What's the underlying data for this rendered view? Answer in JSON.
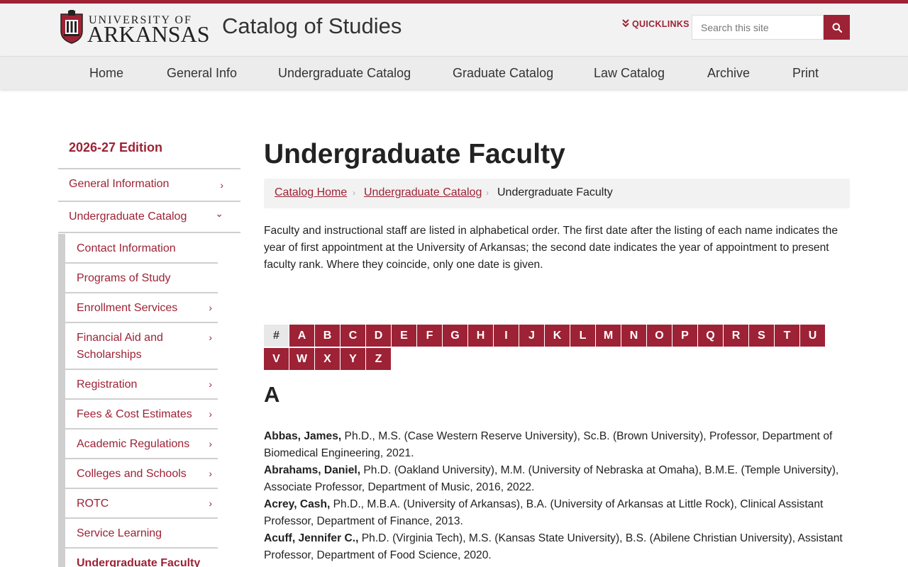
{
  "colors": {
    "brand": "#9d2235",
    "header_bg": "#f2f2f2",
    "nav_bg": "#ececec"
  },
  "header": {
    "logo_top": "UNIVERSITY OF",
    "logo_main": "ARKANSAS",
    "site_title": "Catalog of Studies",
    "quicklinks": "QUICKLINKS",
    "quicklinks_icon": "double-chevron-down-icon",
    "search_placeholder": "Search this site",
    "search_icon": "search-icon"
  },
  "nav": [
    "Home",
    "General Info",
    "Undergraduate Catalog",
    "Graduate Catalog",
    "Law Catalog",
    "Archive",
    "Print"
  ],
  "sidebar": {
    "edition": "2026-27 Edition",
    "top_items": [
      {
        "label": "General Information",
        "icon": "chevron-right-icon",
        "chev": "›"
      },
      {
        "label": "Undergraduate Catalog",
        "icon": "chevron-down-icon",
        "chev": "⌄"
      }
    ],
    "sub_items": [
      {
        "label": "Contact Information",
        "has_children": false
      },
      {
        "label": "Programs of Study",
        "has_children": false
      },
      {
        "label": "Enrollment Services",
        "has_children": true
      },
      {
        "label": "Financial Aid and Scholarships",
        "has_children": true
      },
      {
        "label": "Registration",
        "has_children": true
      },
      {
        "label": "Fees & Cost Estimates",
        "has_children": true
      },
      {
        "label": "Academic Regulations",
        "has_children": true
      },
      {
        "label": "Colleges and Schools",
        "has_children": true
      },
      {
        "label": "ROTC",
        "has_children": true
      },
      {
        "label": "Service Learning",
        "has_children": false
      },
      {
        "label": "Undergraduate Faculty",
        "has_children": false,
        "current": true
      }
    ]
  },
  "main": {
    "title": "Undergraduate Faculty",
    "breadcrumb": {
      "links": [
        "Catalog Home",
        "Undergraduate Catalog"
      ],
      "current": "Undergraduate Faculty"
    },
    "intro": "Faculty and instructional staff are listed in alphabetical order. The first date after the listing of each name indicates the year of first appointment at the University of Arkansas; the second date indicates the year of appointment to present faculty rank. Where they coincide, only one date is given.",
    "az": [
      "#",
      "A",
      "B",
      "C",
      "D",
      "E",
      "F",
      "G",
      "H",
      "I",
      "J",
      "K",
      "L",
      "M",
      "N",
      "O",
      "P",
      "Q",
      "R",
      "S",
      "T",
      "U",
      "V",
      "W",
      "X",
      "Y",
      "Z"
    ],
    "az_current": "#",
    "section_letter": "A",
    "entries": [
      {
        "name": "Abbas, James,",
        "details": " Ph.D., M.S. (Case Western Reserve University), Sc.B. (Brown University), Professor, Department of Biomedical Engineering, 2021."
      },
      {
        "name": "Abrahams, Daniel,",
        "details": " Ph.D. (Oakland University), M.M. (University of Nebraska at Omaha), B.M.E. (Temple University), Associate Professor, Department of Music, 2016, 2022."
      },
      {
        "name": "Acrey, Cash,",
        "details": " Ph.D., M.B.A. (University of Arkansas), B.A. (University of Arkansas at Little Rock), Clinical Assistant Professor, Department of Finance, 2013."
      },
      {
        "name": "Acuff, Jennifer C.,",
        "details": " Ph.D. (Virginia Tech), M.S. (Kansas State University), B.S. (Abilene Christian University), Assistant Professor, Department of Food Science, 2020."
      }
    ]
  }
}
